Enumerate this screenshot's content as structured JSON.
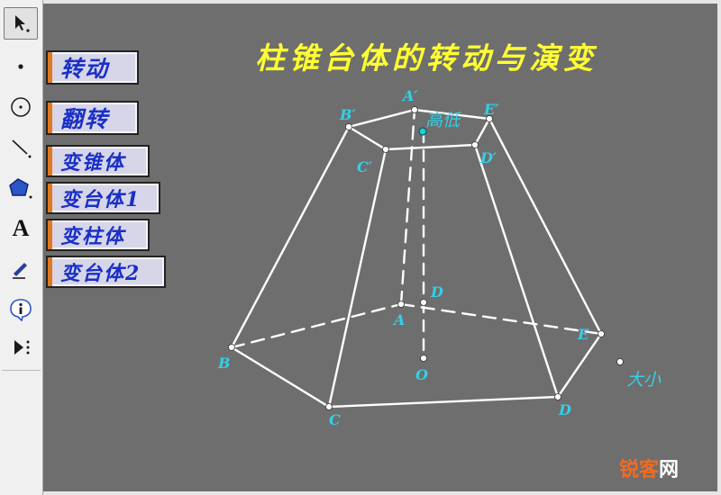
{
  "toolbar": {
    "tools": [
      {
        "name": "arrow-select-tool",
        "selected": true
      },
      {
        "name": "point-tool",
        "selected": false
      },
      {
        "name": "compass-tool",
        "selected": false
      },
      {
        "name": "straightedge-tool",
        "selected": false
      },
      {
        "name": "polygon-tool",
        "selected": false
      },
      {
        "name": "text-tool",
        "label": "A",
        "selected": false
      },
      {
        "name": "marker-tool",
        "selected": false
      },
      {
        "name": "information-tool",
        "selected": false
      },
      {
        "name": "custom-tool",
        "selected": false
      }
    ]
  },
  "buttons": {
    "rotate": "转动",
    "flip": "翻转",
    "to_pyramid": "变锥体",
    "to_frustum_1": "变台体1",
    "to_prism": "变柱体",
    "to_frustum_2": "变台体2"
  },
  "title": "柱锥台体的转动与演变",
  "figure": {
    "vertex_labels": {
      "A_prime": "A′",
      "B_prime": "B′",
      "C_prime": "C′",
      "D_prime": "D′",
      "E_prime": "E′",
      "A": "A",
      "B": "B",
      "C": "C",
      "D_bottom": "D",
      "D_center": "D",
      "E": "E",
      "O": "O"
    },
    "control_labels": {
      "height": "高低",
      "size": "大小"
    }
  },
  "watermark": {
    "main": "锐客",
    "tail": "网"
  },
  "colors": {
    "canvas_bg": "#6e6e6e",
    "title": "#ffff33",
    "label": "#33d0e8",
    "edge": "#ffffff",
    "button_text": "#1a2fc7",
    "button_accent": "#e07a22",
    "watermark": "#f36b21"
  }
}
